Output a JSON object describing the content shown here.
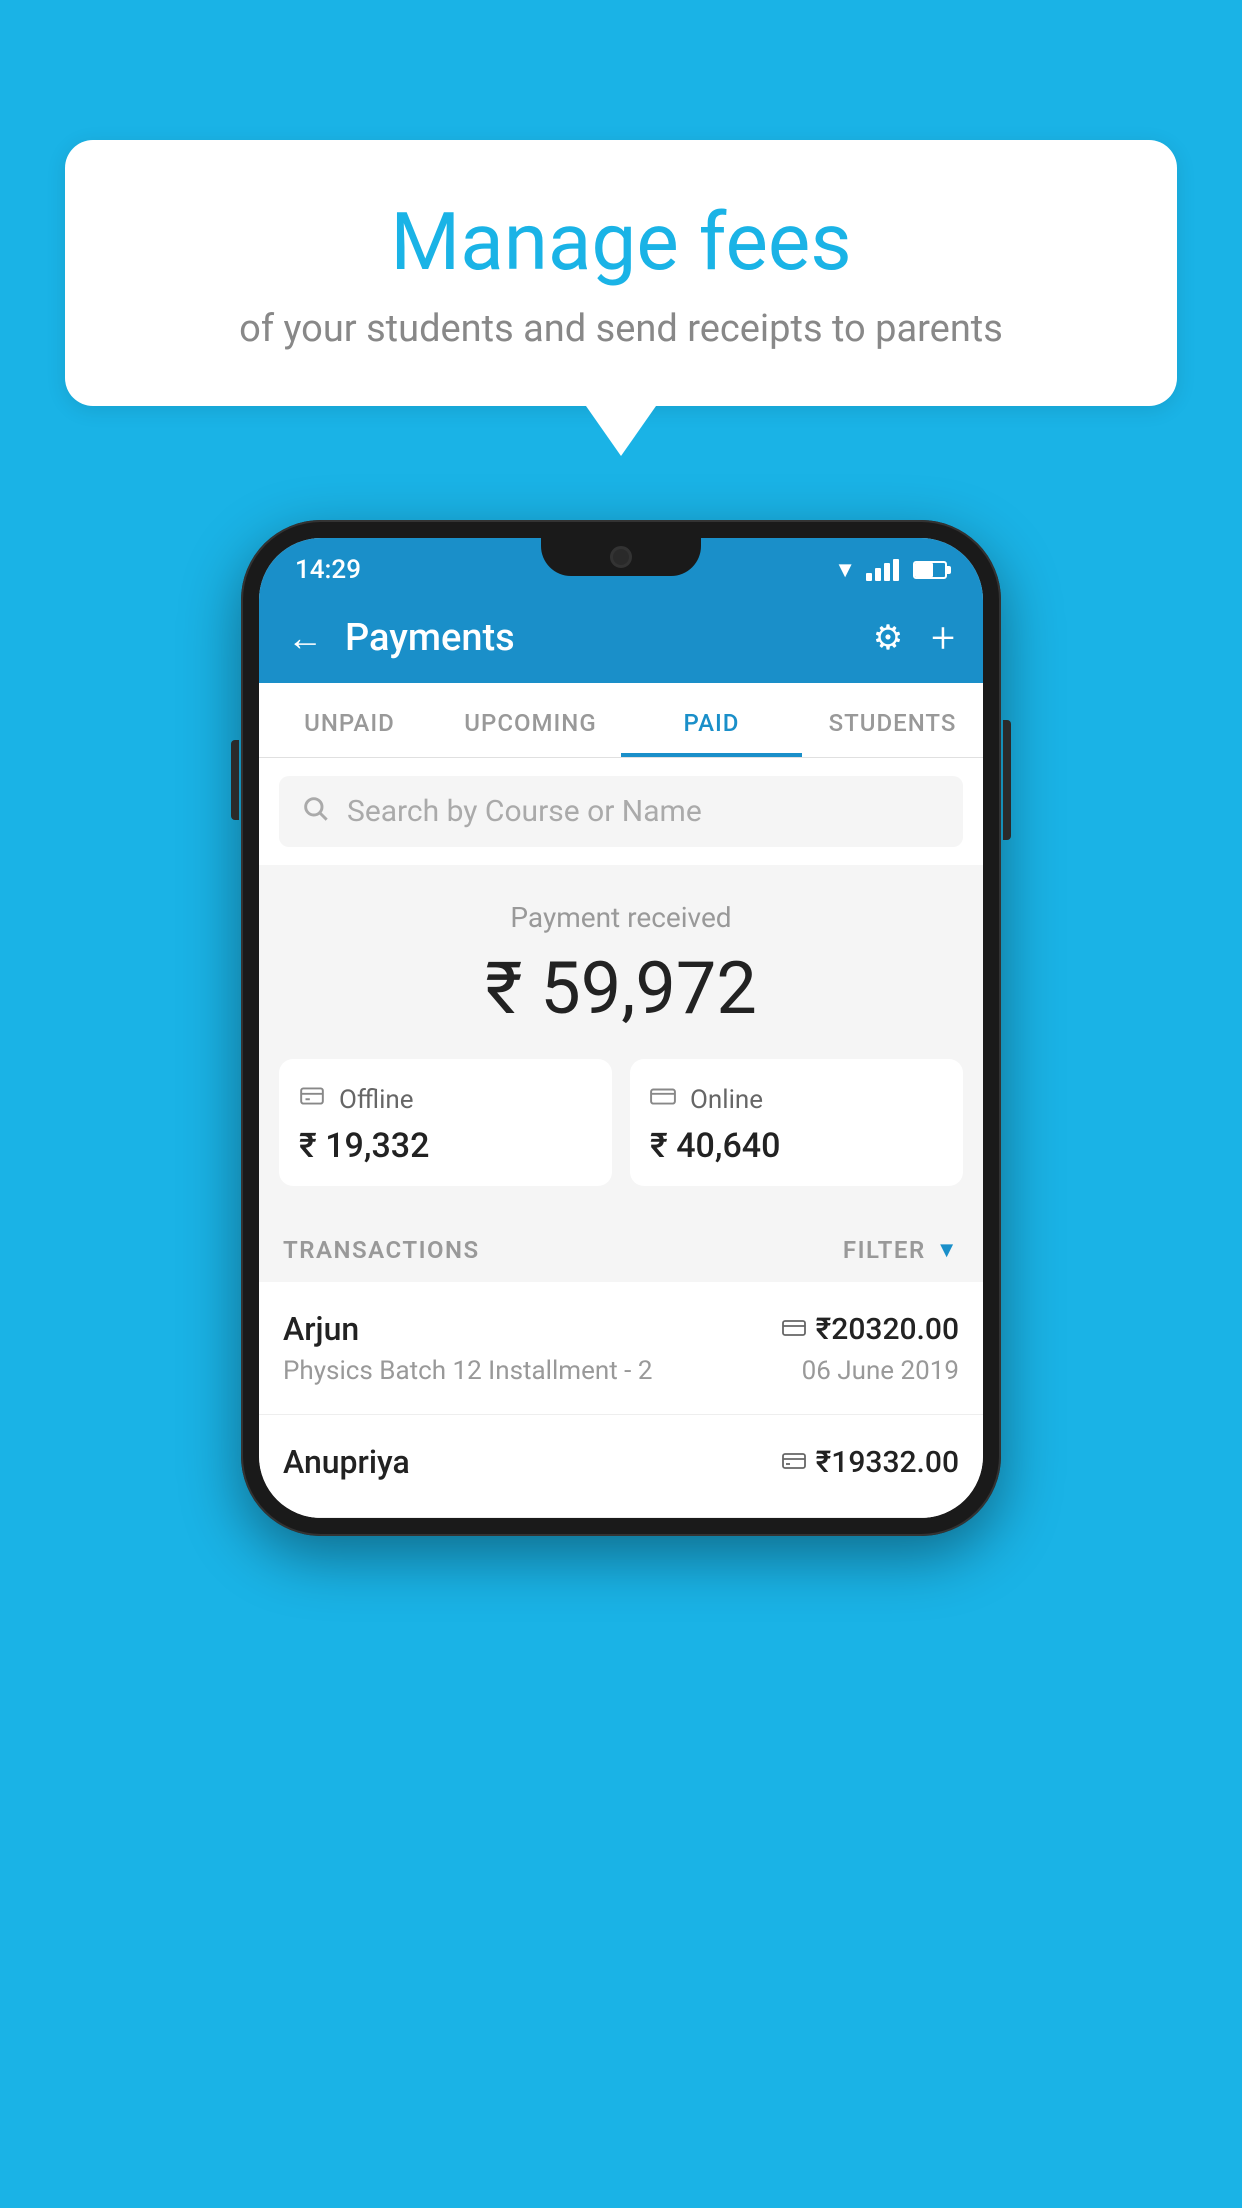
{
  "background_color": "#1ab3e6",
  "speech_bubble": {
    "title": "Manage fees",
    "subtitle": "of your students and send receipts to parents"
  },
  "status_bar": {
    "time": "14:29",
    "wifi": true,
    "signal": true,
    "battery": true
  },
  "header": {
    "title": "Payments",
    "back_label": "←",
    "settings_label": "⚙",
    "add_label": "+"
  },
  "tabs": [
    {
      "label": "UNPAID",
      "active": false
    },
    {
      "label": "UPCOMING",
      "active": false
    },
    {
      "label": "PAID",
      "active": true
    },
    {
      "label": "STUDENTS",
      "active": false
    }
  ],
  "search": {
    "placeholder": "Search by Course or Name"
  },
  "payment_summary": {
    "label": "Payment received",
    "total_amount": "₹ 59,972",
    "offline": {
      "label": "Offline",
      "amount": "₹ 19,332"
    },
    "online": {
      "label": "Online",
      "amount": "₹ 40,640"
    }
  },
  "transactions": {
    "header_label": "TRANSACTIONS",
    "filter_label": "FILTER",
    "rows": [
      {
        "name": "Arjun",
        "course": "Physics Batch 12 Installment - 2",
        "amount": "₹20320.00",
        "date": "06 June 2019",
        "mode": "online"
      },
      {
        "name": "Anupriya",
        "course": "",
        "amount": "₹19332.00",
        "date": "",
        "mode": "offline"
      }
    ]
  }
}
